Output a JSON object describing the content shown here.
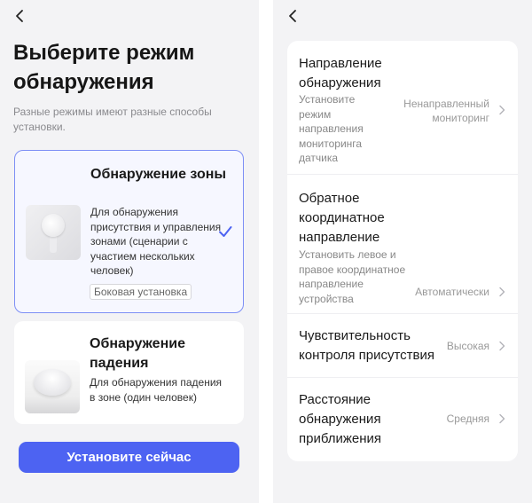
{
  "left_screen": {
    "back_icon": "chevron-left-icon",
    "title": "Выберите режим обнаружения",
    "subtitle": "Разные режимы имеют разные способы установки.",
    "modes": [
      {
        "title": "Обнаружение зоны",
        "description": "Для обнаружения присутствия и управления зонами (сценарии с участием нескольких человек)",
        "tag": "Боковая установка",
        "selected": true,
        "image_icon": "wall-sensor-image"
      },
      {
        "title": "Обнаружение падения",
        "description": "Для обнаружения падения в зоне (один человек)",
        "selected": false,
        "image_icon": "ceiling-sensor-image"
      }
    ],
    "install_button": "Установите сейчас"
  },
  "right_screen": {
    "back_icon": "chevron-left-icon",
    "settings": [
      {
        "title": "Направление обнаружения",
        "description": "Установите режим направления мониторинга датчика",
        "value": "Ненаправленный мониторинг"
      },
      {
        "title": "Обратное координатное направление",
        "description": "Установить левое и правое координатное направление устройства",
        "value": "Автоматически"
      },
      {
        "title": "Чувствительность контроля присутствия",
        "value": "Высокая"
      },
      {
        "title": "Расстояние обнаружения приближения",
        "value": "Средняя"
      }
    ]
  },
  "colors": {
    "accent": "#4d63f2",
    "selected_border": "#7d8ff5",
    "background": "#f3f3f5"
  }
}
